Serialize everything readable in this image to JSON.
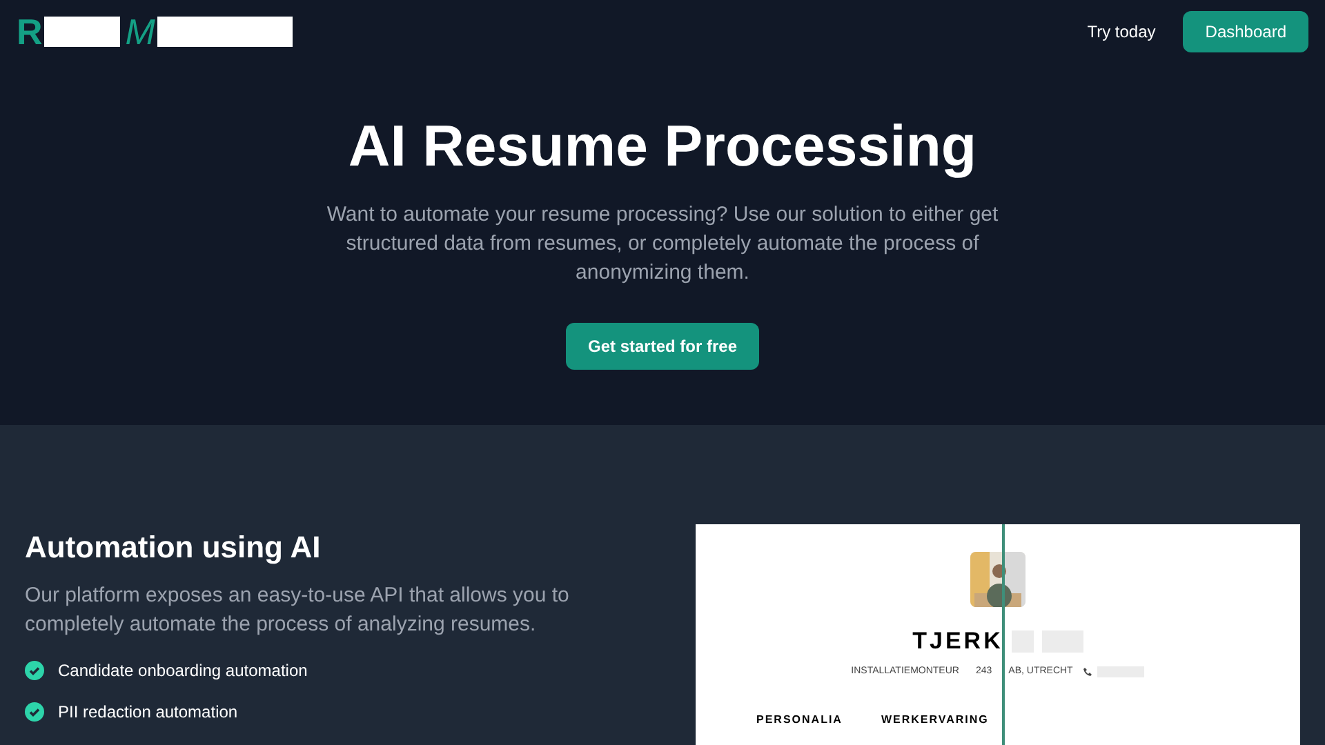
{
  "logo": {
    "letters": [
      "R",
      "M"
    ]
  },
  "nav": {
    "links": [
      "Try today"
    ],
    "button": "Dashboard"
  },
  "hero": {
    "title": "AI Resume Processing",
    "subtitle": "Want to automate your resume processing? Use our solution to either get structured data from resumes, or completely automate the process of anonymizing them.",
    "cta": "Get started for free"
  },
  "feature": {
    "title": "Automation using AI",
    "text": "Our platform exposes an easy-to-use API that allows you to completely automate the process of analyzing resumes.",
    "items": [
      "Candidate onboarding automation",
      "PII redaction automation"
    ]
  },
  "resume": {
    "name": "TJERK",
    "job": "INSTALLATIEMONTEUR",
    "address_start": "243",
    "address_end": "AB, UTRECHT",
    "sections": [
      "PERSONALIA",
      "WERKERVARING"
    ]
  }
}
